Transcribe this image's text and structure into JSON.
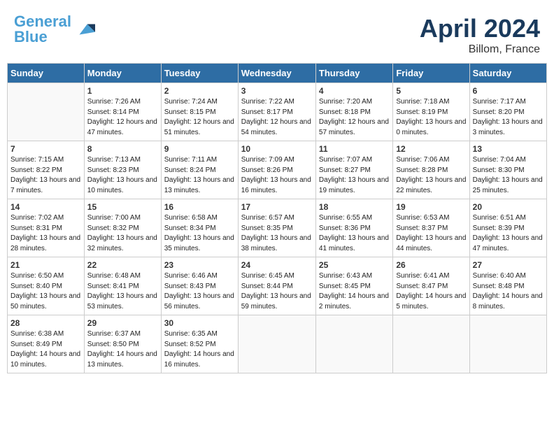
{
  "header": {
    "logo_text_general": "General",
    "logo_text_blue": "Blue",
    "month_year": "April 2024",
    "location": "Billom, France"
  },
  "days_of_week": [
    "Sunday",
    "Monday",
    "Tuesday",
    "Wednesday",
    "Thursday",
    "Friday",
    "Saturday"
  ],
  "weeks": [
    [
      {
        "day": "",
        "empty": true
      },
      {
        "day": "1",
        "sunrise": "Sunrise: 7:26 AM",
        "sunset": "Sunset: 8:14 PM",
        "daylight": "Daylight: 12 hours and 47 minutes."
      },
      {
        "day": "2",
        "sunrise": "Sunrise: 7:24 AM",
        "sunset": "Sunset: 8:15 PM",
        "daylight": "Daylight: 12 hours and 51 minutes."
      },
      {
        "day": "3",
        "sunrise": "Sunrise: 7:22 AM",
        "sunset": "Sunset: 8:17 PM",
        "daylight": "Daylight: 12 hours and 54 minutes."
      },
      {
        "day": "4",
        "sunrise": "Sunrise: 7:20 AM",
        "sunset": "Sunset: 8:18 PM",
        "daylight": "Daylight: 12 hours and 57 minutes."
      },
      {
        "day": "5",
        "sunrise": "Sunrise: 7:18 AM",
        "sunset": "Sunset: 8:19 PM",
        "daylight": "Daylight: 13 hours and 0 minutes."
      },
      {
        "day": "6",
        "sunrise": "Sunrise: 7:17 AM",
        "sunset": "Sunset: 8:20 PM",
        "daylight": "Daylight: 13 hours and 3 minutes."
      }
    ],
    [
      {
        "day": "7",
        "sunrise": "Sunrise: 7:15 AM",
        "sunset": "Sunset: 8:22 PM",
        "daylight": "Daylight: 13 hours and 7 minutes."
      },
      {
        "day": "8",
        "sunrise": "Sunrise: 7:13 AM",
        "sunset": "Sunset: 8:23 PM",
        "daylight": "Daylight: 13 hours and 10 minutes."
      },
      {
        "day": "9",
        "sunrise": "Sunrise: 7:11 AM",
        "sunset": "Sunset: 8:24 PM",
        "daylight": "Daylight: 13 hours and 13 minutes."
      },
      {
        "day": "10",
        "sunrise": "Sunrise: 7:09 AM",
        "sunset": "Sunset: 8:26 PM",
        "daylight": "Daylight: 13 hours and 16 minutes."
      },
      {
        "day": "11",
        "sunrise": "Sunrise: 7:07 AM",
        "sunset": "Sunset: 8:27 PM",
        "daylight": "Daylight: 13 hours and 19 minutes."
      },
      {
        "day": "12",
        "sunrise": "Sunrise: 7:06 AM",
        "sunset": "Sunset: 8:28 PM",
        "daylight": "Daylight: 13 hours and 22 minutes."
      },
      {
        "day": "13",
        "sunrise": "Sunrise: 7:04 AM",
        "sunset": "Sunset: 8:30 PM",
        "daylight": "Daylight: 13 hours and 25 minutes."
      }
    ],
    [
      {
        "day": "14",
        "sunrise": "Sunrise: 7:02 AM",
        "sunset": "Sunset: 8:31 PM",
        "daylight": "Daylight: 13 hours and 28 minutes."
      },
      {
        "day": "15",
        "sunrise": "Sunrise: 7:00 AM",
        "sunset": "Sunset: 8:32 PM",
        "daylight": "Daylight: 13 hours and 32 minutes."
      },
      {
        "day": "16",
        "sunrise": "Sunrise: 6:58 AM",
        "sunset": "Sunset: 8:34 PM",
        "daylight": "Daylight: 13 hours and 35 minutes."
      },
      {
        "day": "17",
        "sunrise": "Sunrise: 6:57 AM",
        "sunset": "Sunset: 8:35 PM",
        "daylight": "Daylight: 13 hours and 38 minutes."
      },
      {
        "day": "18",
        "sunrise": "Sunrise: 6:55 AM",
        "sunset": "Sunset: 8:36 PM",
        "daylight": "Daylight: 13 hours and 41 minutes."
      },
      {
        "day": "19",
        "sunrise": "Sunrise: 6:53 AM",
        "sunset": "Sunset: 8:37 PM",
        "daylight": "Daylight: 13 hours and 44 minutes."
      },
      {
        "day": "20",
        "sunrise": "Sunrise: 6:51 AM",
        "sunset": "Sunset: 8:39 PM",
        "daylight": "Daylight: 13 hours and 47 minutes."
      }
    ],
    [
      {
        "day": "21",
        "sunrise": "Sunrise: 6:50 AM",
        "sunset": "Sunset: 8:40 PM",
        "daylight": "Daylight: 13 hours and 50 minutes."
      },
      {
        "day": "22",
        "sunrise": "Sunrise: 6:48 AM",
        "sunset": "Sunset: 8:41 PM",
        "daylight": "Daylight: 13 hours and 53 minutes."
      },
      {
        "day": "23",
        "sunrise": "Sunrise: 6:46 AM",
        "sunset": "Sunset: 8:43 PM",
        "daylight": "Daylight: 13 hours and 56 minutes."
      },
      {
        "day": "24",
        "sunrise": "Sunrise: 6:45 AM",
        "sunset": "Sunset: 8:44 PM",
        "daylight": "Daylight: 13 hours and 59 minutes."
      },
      {
        "day": "25",
        "sunrise": "Sunrise: 6:43 AM",
        "sunset": "Sunset: 8:45 PM",
        "daylight": "Daylight: 14 hours and 2 minutes."
      },
      {
        "day": "26",
        "sunrise": "Sunrise: 6:41 AM",
        "sunset": "Sunset: 8:47 PM",
        "daylight": "Daylight: 14 hours and 5 minutes."
      },
      {
        "day": "27",
        "sunrise": "Sunrise: 6:40 AM",
        "sunset": "Sunset: 8:48 PM",
        "daylight": "Daylight: 14 hours and 8 minutes."
      }
    ],
    [
      {
        "day": "28",
        "sunrise": "Sunrise: 6:38 AM",
        "sunset": "Sunset: 8:49 PM",
        "daylight": "Daylight: 14 hours and 10 minutes."
      },
      {
        "day": "29",
        "sunrise": "Sunrise: 6:37 AM",
        "sunset": "Sunset: 8:50 PM",
        "daylight": "Daylight: 14 hours and 13 minutes."
      },
      {
        "day": "30",
        "sunrise": "Sunrise: 6:35 AM",
        "sunset": "Sunset: 8:52 PM",
        "daylight": "Daylight: 14 hours and 16 minutes."
      },
      {
        "day": "",
        "empty": true
      },
      {
        "day": "",
        "empty": true
      },
      {
        "day": "",
        "empty": true
      },
      {
        "day": "",
        "empty": true
      }
    ]
  ]
}
